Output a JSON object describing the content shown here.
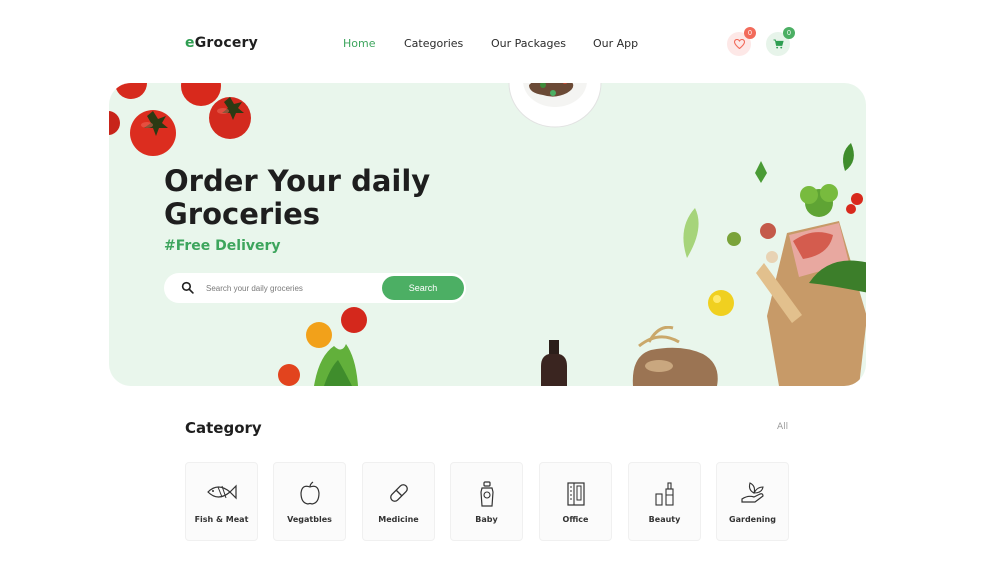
{
  "header": {
    "logo_prefix": "e",
    "logo_rest": "Grocery",
    "nav": [
      {
        "label": "Home",
        "active": true
      },
      {
        "label": "Categories",
        "active": false
      },
      {
        "label": "Our Packages",
        "active": false
      },
      {
        "label": "Our App",
        "active": false
      }
    ],
    "wishlist_count": "0",
    "cart_count": "0",
    "icons": {
      "wishlist": "heart-icon",
      "cart": "cart-icon"
    }
  },
  "hero": {
    "title": "Order Your daily Groceries",
    "subtitle": "#Free Delivery",
    "search_placeholder": "Search your daily groceries",
    "search_button": "Search"
  },
  "category": {
    "title": "Category",
    "all_link": "All",
    "items": [
      {
        "label": "Fish & Meat",
        "icon": "fish-icon"
      },
      {
        "label": "Vegatbles",
        "icon": "apple-icon"
      },
      {
        "label": "Medicine",
        "icon": "pill-icon"
      },
      {
        "label": "Baby",
        "icon": "baby-icon"
      },
      {
        "label": "Office",
        "icon": "office-icon"
      },
      {
        "label": "Beauty",
        "icon": "beauty-bottles-icon"
      },
      {
        "label": "Gardening",
        "icon": "gardening-icon"
      }
    ]
  },
  "colors": {
    "accent": "#4caf64",
    "hero_bg": "#e9f6ec",
    "badge_red": "#f26b5b"
  }
}
